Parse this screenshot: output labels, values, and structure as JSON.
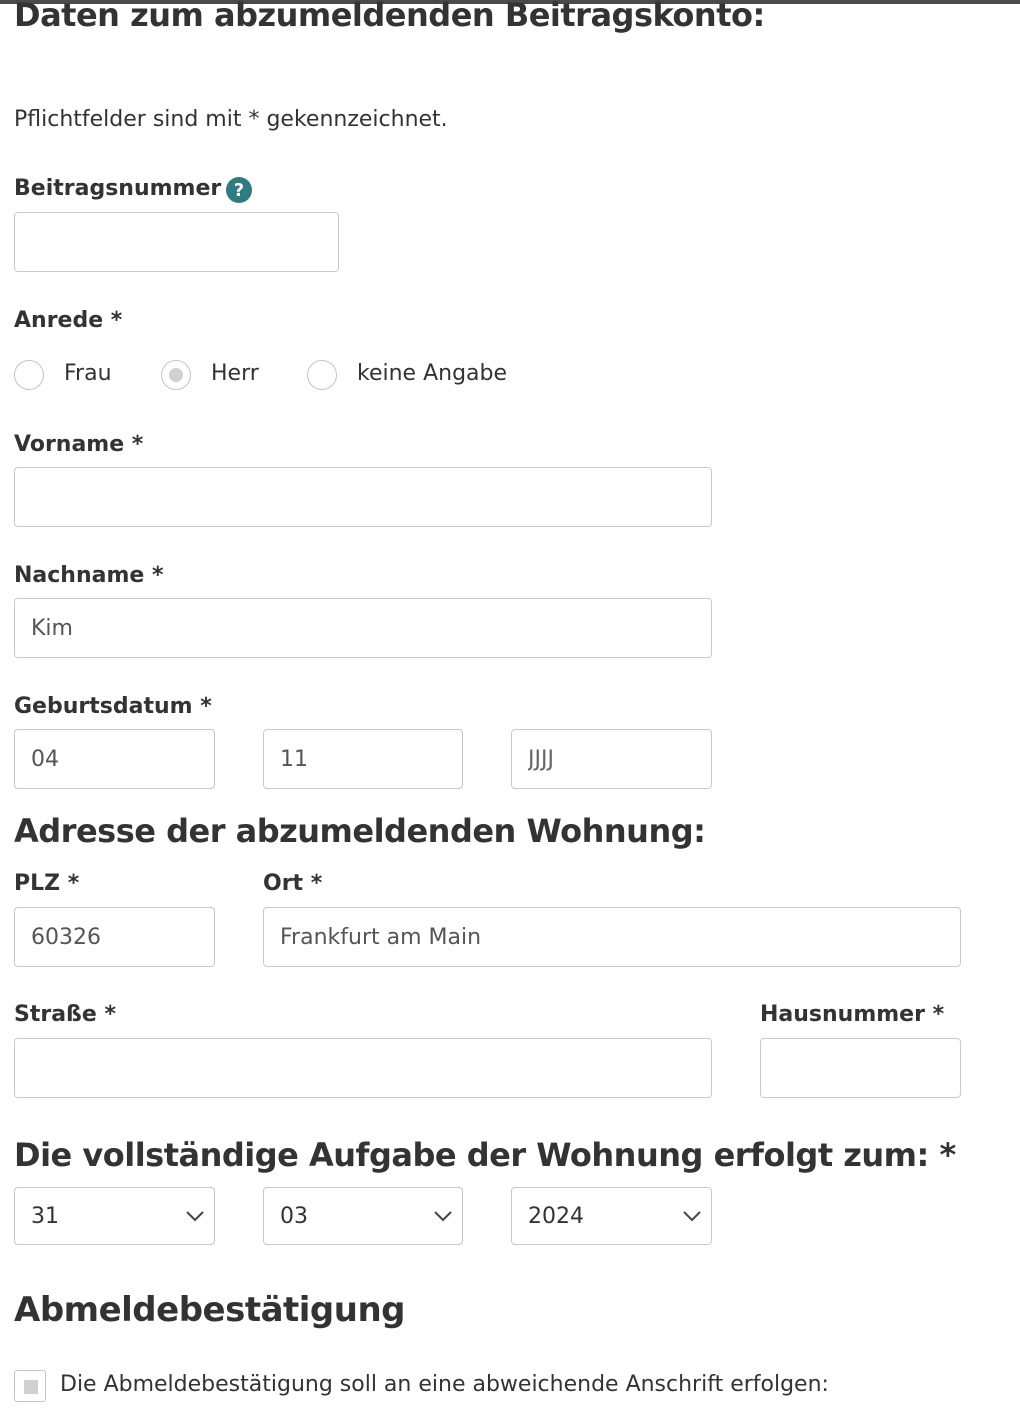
{
  "section_contribution": {
    "heading": "Daten zum abzumeldenden Beitragskonto:",
    "required_note": "Pflichtfelder sind mit * gekennzeichnet.",
    "beitragsnummer": {
      "label": "Beitragsnummer *",
      "value": "",
      "help_icon": "question-circle-icon",
      "help_glyph": "?"
    },
    "anrede": {
      "label": "Anrede *",
      "options": [
        "Frau",
        "Herr",
        "keine Angabe"
      ],
      "selected": "Herr"
    },
    "vorname": {
      "label": "Vorname *",
      "value": ""
    },
    "nachname": {
      "label": "Nachname *",
      "value": "Kim"
    },
    "geburtsdatum": {
      "label": "Geburtsdatum *",
      "day": "04",
      "month": "11",
      "year_placeholder": "JJJJ"
    }
  },
  "section_address": {
    "heading": "Adresse der abzumeldenden Wohnung:",
    "plz": {
      "label": "PLZ *",
      "value": "60326"
    },
    "ort": {
      "label": "Ort *",
      "value": "Frankfurt am Main"
    },
    "strasse": {
      "label": "Straße *",
      "value": ""
    },
    "hausnummer": {
      "label": "Hausnummer *",
      "value": ""
    }
  },
  "section_move_out": {
    "heading": "Die vollständige Aufgabe der Wohnung erfolgt zum: *",
    "day": "31",
    "month": "03",
    "year": "2024"
  },
  "section_confirmation": {
    "heading": "Abmeldebestätigung",
    "checkbox_label": "Die Abmeldebestätigung soll an eine abweichende Anschrift erfolgen:"
  },
  "colors": {
    "help_icon": "#2f7b82",
    "text": "#333333",
    "border": "#c9c9c9"
  }
}
